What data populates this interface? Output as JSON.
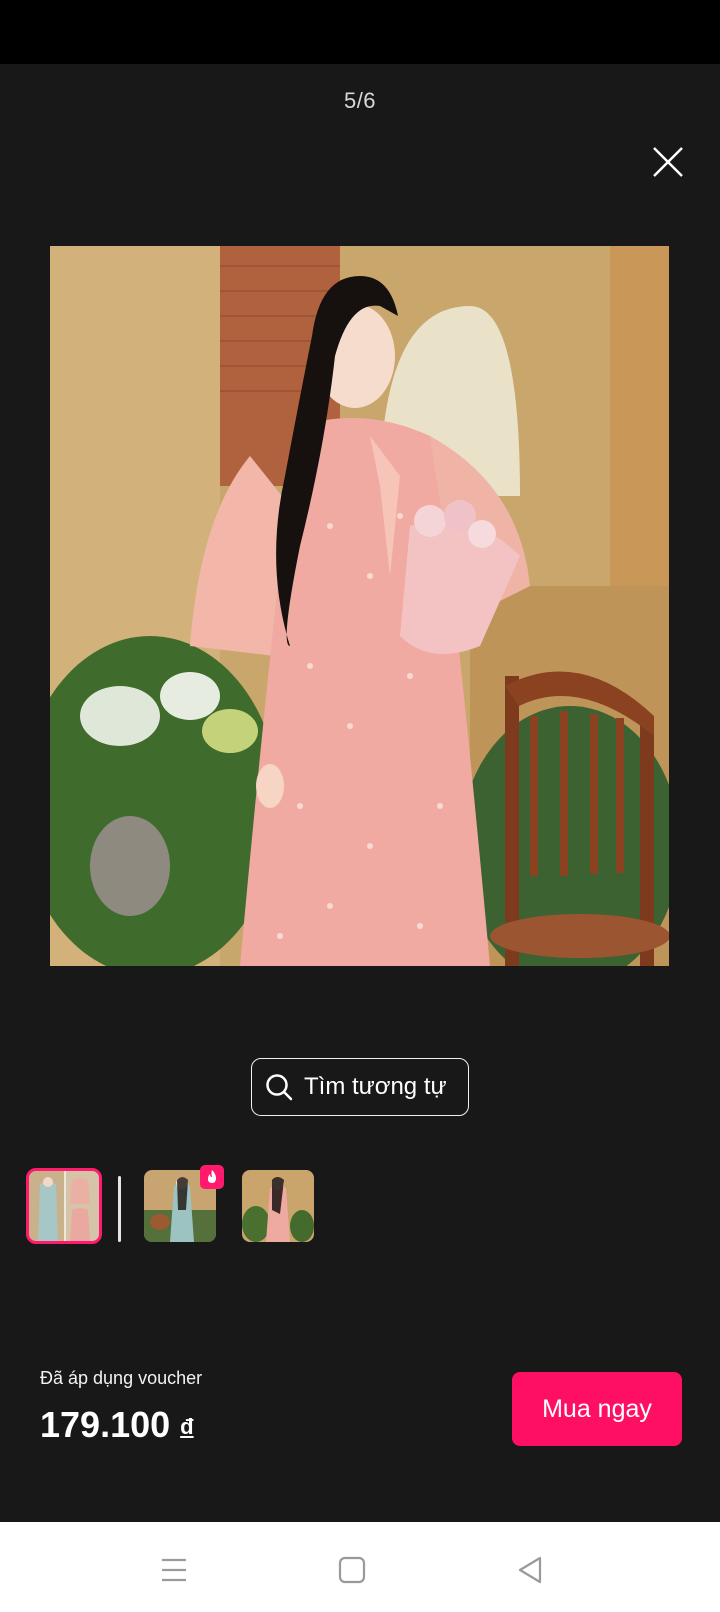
{
  "viewer": {
    "page_counter": "5/6",
    "close_icon": "close-icon"
  },
  "search": {
    "label": "Tìm tương tự",
    "icon": "search-icon"
  },
  "thumbnails": [
    {
      "name": "thumbnail-1",
      "selected": true
    },
    {
      "name": "thumbnail-2",
      "badge": "fire-icon"
    },
    {
      "name": "thumbnail-3"
    }
  ],
  "footer": {
    "voucher_label": "Đã áp dụng voucher",
    "price": "179.100",
    "currency": "đ",
    "buy_label": "Mua ngay"
  },
  "nav": {
    "menu_icon": "menu-icon",
    "home_icon": "home-icon",
    "back_icon": "back-icon"
  },
  "colors": {
    "accent": "#ff0f64",
    "background": "#181818"
  }
}
